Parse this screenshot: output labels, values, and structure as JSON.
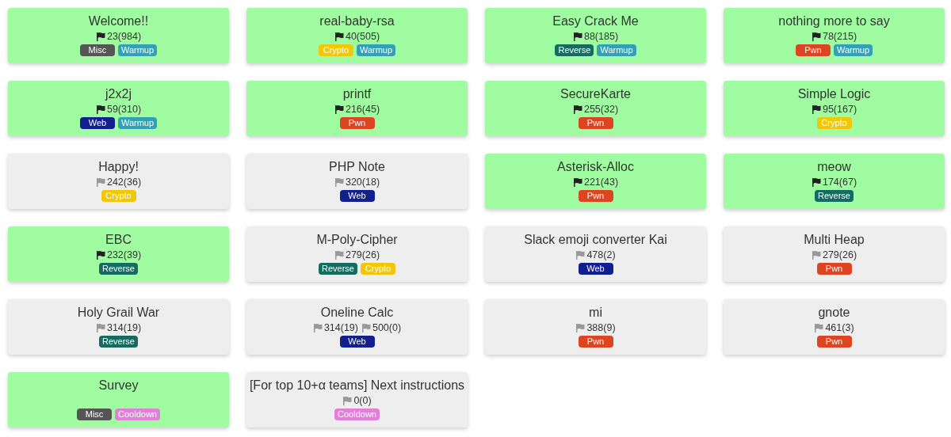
{
  "challenges": [
    {
      "title": "Welcome!!",
      "solved": true,
      "scores": [
        "23(984)"
      ],
      "tags": [
        {
          "label": "Misc",
          "color": "#555555"
        },
        {
          "label": "Warmup",
          "color": "#33a1b5"
        }
      ]
    },
    {
      "title": "real-baby-rsa",
      "solved": true,
      "scores": [
        "40(505)"
      ],
      "tags": [
        {
          "label": "Crypto",
          "color": "#f0c808"
        },
        {
          "label": "Warmup",
          "color": "#33a1b5"
        }
      ]
    },
    {
      "title": "Easy Crack Me",
      "solved": true,
      "scores": [
        "88(185)"
      ],
      "tags": [
        {
          "label": "Reverse",
          "color": "#146b5f"
        },
        {
          "label": "Warmup",
          "color": "#33a1b5"
        }
      ]
    },
    {
      "title": "nothing more to say",
      "solved": true,
      "scores": [
        "78(215)"
      ],
      "tags": [
        {
          "label": "Pwn",
          "color": "#dd4422"
        },
        {
          "label": "Warmup",
          "color": "#33a1b5"
        }
      ]
    },
    {
      "title": "j2x2j",
      "solved": true,
      "scores": [
        "59(310)"
      ],
      "tags": [
        {
          "label": "Web",
          "color": "#121f8f"
        },
        {
          "label": "Warmup",
          "color": "#33a1b5"
        }
      ]
    },
    {
      "title": "printf",
      "solved": true,
      "scores": [
        "216(45)"
      ],
      "tags": [
        {
          "label": "Pwn",
          "color": "#dd4422"
        }
      ]
    },
    {
      "title": "SecureKarte",
      "solved": true,
      "scores": [
        "255(32)"
      ],
      "tags": [
        {
          "label": "Pwn",
          "color": "#dd4422"
        }
      ]
    },
    {
      "title": "Simple Logic",
      "solved": true,
      "scores": [
        "95(167)"
      ],
      "tags": [
        {
          "label": "Crypto",
          "color": "#f0c808"
        }
      ]
    },
    {
      "title": "Happy!",
      "solved": false,
      "scores": [
        "242(36)"
      ],
      "tags": [
        {
          "label": "Crypto",
          "color": "#f0c808"
        }
      ]
    },
    {
      "title": "PHP Note",
      "solved": false,
      "scores": [
        "320(18)"
      ],
      "tags": [
        {
          "label": "Web",
          "color": "#121f8f"
        }
      ]
    },
    {
      "title": "Asterisk-Alloc",
      "solved": true,
      "scores": [
        "221(43)"
      ],
      "tags": [
        {
          "label": "Pwn",
          "color": "#dd4422"
        }
      ]
    },
    {
      "title": "meow",
      "solved": true,
      "scores": [
        "174(67)"
      ],
      "tags": [
        {
          "label": "Reverse",
          "color": "#146b5f"
        }
      ]
    },
    {
      "title": "EBC",
      "solved": true,
      "scores": [
        "232(39)"
      ],
      "tags": [
        {
          "label": "Reverse",
          "color": "#146b5f"
        }
      ]
    },
    {
      "title": "M-Poly-Cipher",
      "solved": false,
      "scores": [
        "279(26)"
      ],
      "tags": [
        {
          "label": "Reverse",
          "color": "#146b5f"
        },
        {
          "label": "Crypto",
          "color": "#f0c808"
        }
      ]
    },
    {
      "title": "Slack emoji converter Kai",
      "solved": false,
      "scores": [
        "478(2)"
      ],
      "tags": [
        {
          "label": "Web",
          "color": "#121f8f"
        }
      ]
    },
    {
      "title": "Multi Heap",
      "solved": false,
      "scores": [
        "279(26)"
      ],
      "tags": [
        {
          "label": "Pwn",
          "color": "#dd4422"
        }
      ]
    },
    {
      "title": "Holy Grail War",
      "solved": false,
      "scores": [
        "314(19)"
      ],
      "tags": [
        {
          "label": "Reverse",
          "color": "#146b5f"
        }
      ]
    },
    {
      "title": "Oneline Calc",
      "solved": false,
      "scores": [
        "314(19)",
        "500(0)"
      ],
      "tags": [
        {
          "label": "Web",
          "color": "#121f8f"
        }
      ]
    },
    {
      "title": "mi",
      "solved": false,
      "scores": [
        "388(9)"
      ],
      "tags": [
        {
          "label": "Pwn",
          "color": "#dd4422"
        }
      ]
    },
    {
      "title": "gnote",
      "solved": false,
      "scores": [
        "461(3)"
      ],
      "tags": [
        {
          "label": "Pwn",
          "color": "#dd4422"
        }
      ]
    },
    {
      "title": "Survey",
      "solved": true,
      "tags": [
        {
          "label": "Misc",
          "color": "#555555"
        },
        {
          "label": "Cooldown",
          "color": "#e080d8"
        }
      ]
    },
    {
      "title": "[For top 10+α teams] Next instructions",
      "solved": false,
      "scores": [
        "0(0)"
      ],
      "tags": [
        {
          "label": "Cooldown",
          "color": "#e080d8"
        }
      ]
    }
  ]
}
